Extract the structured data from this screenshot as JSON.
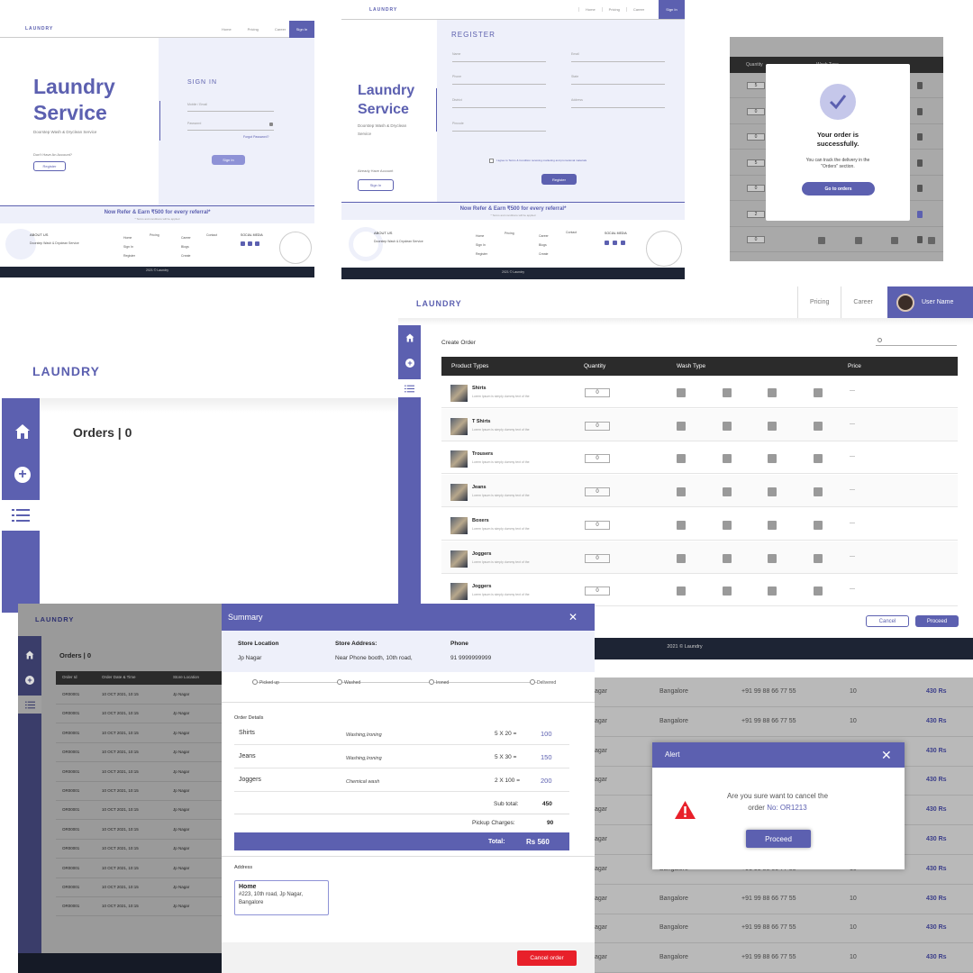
{
  "colors": {
    "indigo": "#5c60b0",
    "navy": "#1d2434",
    "red": "#e8202a",
    "grey": "#9a9a9a"
  },
  "signin": {
    "brand": "LAUNDRY",
    "nav": [
      "Home",
      "Pricing",
      "Career"
    ],
    "nav_button": "Sign In",
    "hero_title": "Laundry Service",
    "hero_sub": "Doorstep Wash & Dryclean Service",
    "no_account": "Don't Have An Account?",
    "register_btn": "Register",
    "form_title": "SIGN IN",
    "field_mobile": "Mobile / Email",
    "field_password": "Password",
    "forgot": "Forgot Password?",
    "submit": "Sign In",
    "refer": "Now Refer & Earn ₹500 for every referral*",
    "refer_small": "* Terms and conditions will be applied",
    "footer_about": "ABOUT US",
    "footer_about_text": "Doorstep Wash & Dryclean Service",
    "footer_cols": [
      [
        "Home",
        "Sign In",
        "Register"
      ],
      [
        "Pricing"
      ],
      [
        "Career",
        "Blogs",
        "Create"
      ],
      [
        "Contact"
      ]
    ],
    "social": "SOCIAL MEDIA",
    "copyright": "2021 © Laundry"
  },
  "register": {
    "brand": "LAUNDRY",
    "nav": [
      "Home",
      "Pricing",
      "Career"
    ],
    "nav_button": "Sign In",
    "hero_title": "Laundry Service",
    "hero_sub": "Doorstep Wash & Dryclean Service",
    "have_account": "Already Have Account",
    "signin_btn": "Sign In",
    "form_title": "REGISTER",
    "fields": [
      "Name",
      "Email",
      "Phone",
      "State",
      "District",
      "Address",
      "Pincode"
    ],
    "terms": "I agree to Terms & Condition receiving marketing and promotional materials",
    "submit": "Register",
    "refer": "Now Refer & Earn ₹500 for every referral*",
    "refer_small": "* Terms and conditions will be applied",
    "footer_about": "ABOUT US",
    "footer_about_text": "Doorstep Wash & Dryclean Service",
    "footer_cols": [
      [
        "Home",
        "Sign In",
        "Register"
      ],
      [
        "Pricing"
      ],
      [
        "Career",
        "Blogs",
        "Create"
      ],
      [
        "Contact"
      ]
    ],
    "social": "SOCIAL MEDIA",
    "copyright": "2021 © Laundry"
  },
  "success": {
    "header": [
      "Quantity",
      "Wash Type"
    ],
    "quantities": [
      "5",
      "0",
      "0",
      "5",
      "0",
      "2",
      "0"
    ],
    "title": "Your order is successfully.",
    "text": "You can track the delivery in the \"Orders\" section.",
    "button": "Go to orders"
  },
  "orders": {
    "brand": "LAUNDRY",
    "title": "Orders | 0"
  },
  "create": {
    "brand": "LAUNDRY",
    "nav": [
      "Pricing",
      "Career"
    ],
    "user": "User Name",
    "title": "Create Order",
    "columns": [
      "Product Types",
      "Quantity",
      "Wash Type",
      "Price"
    ],
    "rows": [
      {
        "name": "Shirts",
        "desc": "Lorem Ipsum is simply dummy text of the",
        "qty": "0",
        "price": "—"
      },
      {
        "name": "T Shirts",
        "desc": "Lorem Ipsum is simply dummy text of the",
        "qty": "0",
        "price": "—"
      },
      {
        "name": "Trousers",
        "desc": "Lorem Ipsum is simply dummy text of the",
        "qty": "0",
        "price": "—"
      },
      {
        "name": "Jeans",
        "desc": "Lorem Ipsum is simply dummy text of the",
        "qty": "0",
        "price": "—"
      },
      {
        "name": "Boxers",
        "desc": "Lorem Ipsum is simply dummy text of the",
        "qty": "0",
        "price": "—"
      },
      {
        "name": "Joggers",
        "desc": "Lorem Ipsum is simply dummy text of the",
        "qty": "0",
        "price": "—"
      },
      {
        "name": "Joggers",
        "desc": "Lorem Ipsum is simply dummy text of the",
        "qty": "0",
        "price": "—"
      }
    ],
    "cancel": "Cancel",
    "proceed": "Proceed",
    "footer": "2021 © Laundry"
  },
  "orders_list": {
    "brand": "LAUNDRY",
    "title": "Orders | 0",
    "columns": [
      "Order Id",
      "Order Date & Time",
      "Store Location"
    ],
    "rows": [
      [
        "OR00001",
        "10 OCT 2021, 10:15",
        "Jp Nagar"
      ],
      [
        "OR00001",
        "10 OCT 2021, 10:15",
        "Jp Nagar"
      ],
      [
        "OR00001",
        "10 OCT 2021, 10:15",
        "Jp Nagar"
      ],
      [
        "OR00001",
        "10 OCT 2021, 10:15",
        "Jp Nagar"
      ],
      [
        "OR00001",
        "10 OCT 2021, 10:15",
        "Jp Nagar"
      ],
      [
        "OR00001",
        "10 OCT 2021, 10:15",
        "Jp Nagar"
      ],
      [
        "OR00001",
        "10 OCT 2021, 10:15",
        "Jp Nagar"
      ],
      [
        "OR00001",
        "10 OCT 2021, 10:15",
        "Jp Nagar"
      ],
      [
        "OR00001",
        "10 OCT 2021, 10:15",
        "Jp Nagar"
      ],
      [
        "OR00001",
        "10 OCT 2021, 10:15",
        "Jp Nagar"
      ],
      [
        "OR00001",
        "10 OCT 2021, 10:15",
        "Jp Nagar"
      ],
      [
        "OR00001",
        "10 OCT 2021, 10:15",
        "Jp Nagar"
      ]
    ]
  },
  "summary": {
    "title": "Summary",
    "store_location_label": "Store Location",
    "store_location": "Jp Nagar",
    "store_address_label": "Store Address:",
    "store_address": "Near Phone booth, 10th road,",
    "phone_label": "Phone",
    "phone": "91 9999999999",
    "steps": [
      "Picked up",
      "Washed",
      "Ironed",
      "Delivered"
    ],
    "details_label": "Order Details",
    "items": [
      {
        "name": "Shirts",
        "type": "Washing,Ironing",
        "calc": "5 X 20 =",
        "amount": "100"
      },
      {
        "name": "Jeans",
        "type": "Washing,Ironing",
        "calc": "5 X 30 =",
        "amount": "150"
      },
      {
        "name": "Joggers",
        "type": "Chemical wash",
        "calc": "2 X 100 =",
        "amount": "200"
      }
    ],
    "subtotal_label": "Sub total:",
    "subtotal": "450",
    "pickup_label": "Pickup Charges:",
    "pickup": "90",
    "total_label": "Total:",
    "total": "Rs 560",
    "address_label": "Address",
    "address_title": "Home",
    "address_text": "#223, 10th road, Jp Nagar, Bangalore",
    "cancel": "Cancel order"
  },
  "alertbg": {
    "rows": [
      [
        "agar",
        "Bangalore",
        "+91 99 88 66 77 55",
        "10",
        "430 Rs"
      ],
      [
        "agar",
        "Bangalore",
        "+91 99 88 66 77 55",
        "10",
        "430 Rs"
      ],
      [
        "agar",
        "Bangalore",
        "+91 99 88 66 77 55",
        "10",
        "430 Rs"
      ],
      [
        "agar",
        "Bangalore",
        "+91 99 88 66 77 55",
        "10",
        "430 Rs"
      ],
      [
        "agar",
        "Bangalore",
        "+91 99 88 66 77 55",
        "10",
        "430 Rs"
      ],
      [
        "agar",
        "Bangalore",
        "+91 99 88 66 77 55",
        "10",
        "430 Rs"
      ],
      [
        "agar",
        "Bangalore",
        "+91 99 88 66 77 55",
        "10",
        "430 Rs"
      ],
      [
        "agar",
        "Bangalore",
        "+91 99 88 66 77 55",
        "10",
        "430 Rs"
      ],
      [
        "agar",
        "Bangalore",
        "+91 99 88 66 77 55",
        "10",
        "430 Rs"
      ],
      [
        "agar",
        "Bangalore",
        "+91 99 88 66 77 55",
        "10",
        "430 Rs"
      ]
    ]
  },
  "alert": {
    "title": "Alert",
    "message": "Are you sure want to cancel the",
    "order_prefix": "order",
    "order_no": "No: OR1213",
    "button": "Proceed"
  }
}
